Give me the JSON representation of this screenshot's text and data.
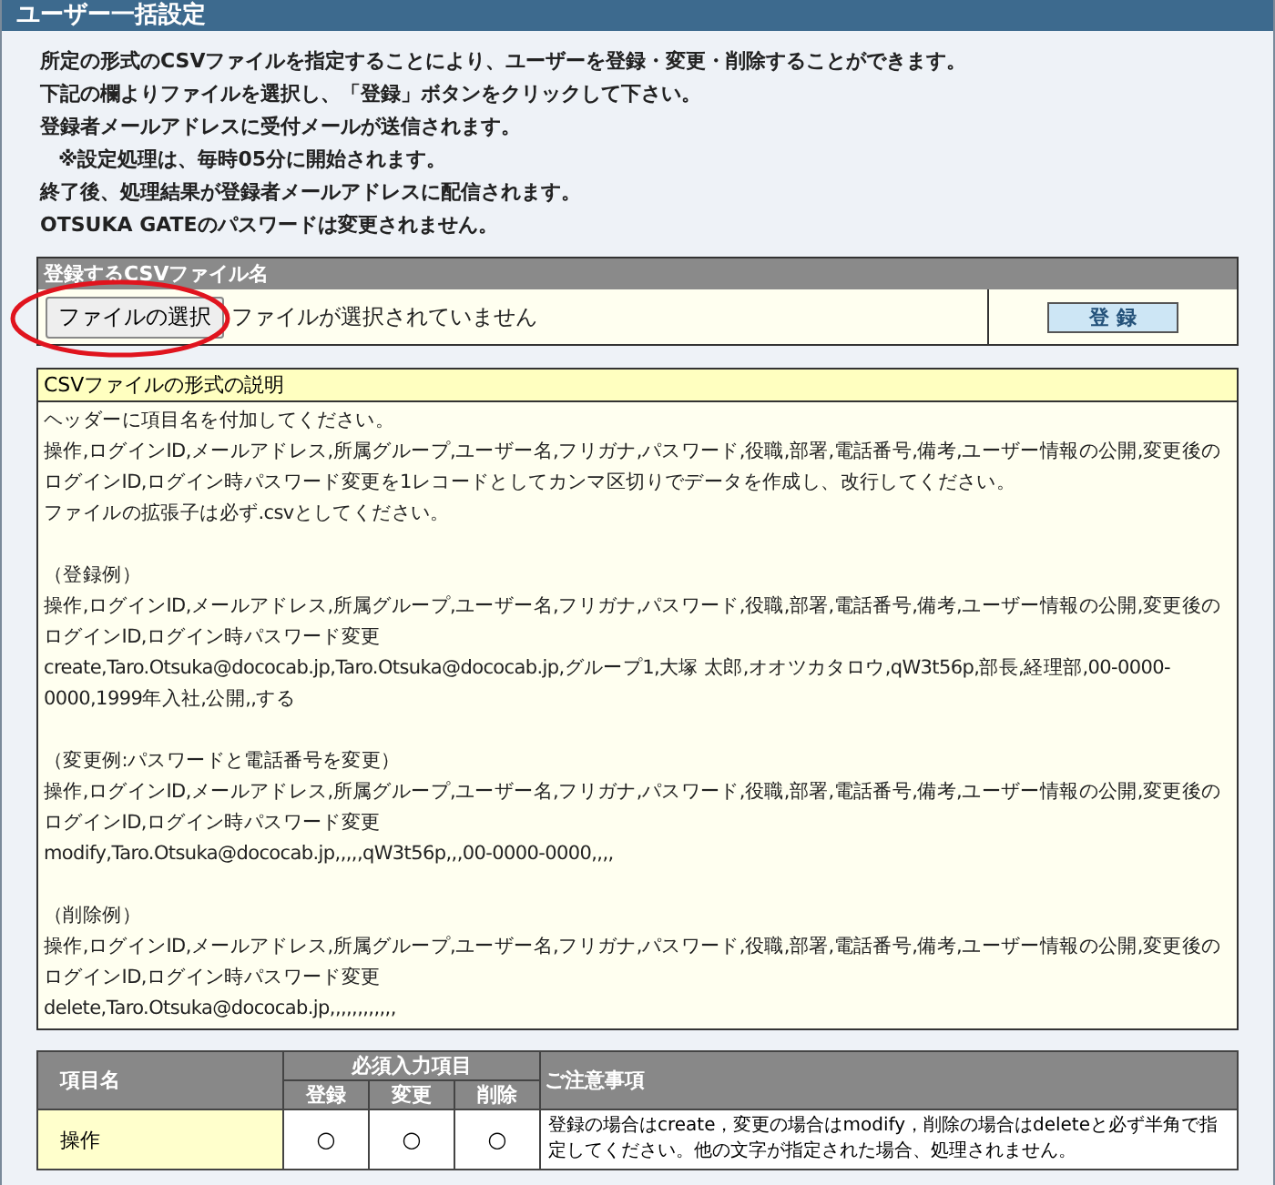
{
  "header": {
    "title": "ユーザー一括設定"
  },
  "intro": [
    {
      "kind": "plain",
      "text": "所定の形式のCSVファイルを指定することにより、ユーザーを登録・変更・削除することができます。"
    },
    {
      "kind": "plain",
      "text": "下記の欄よりファイルを選択し、「登録」ボタンをクリックして下さい。"
    },
    {
      "kind": "plain",
      "text": "登録者メールアドレスに受付メールが送信されます。"
    },
    {
      "kind": "note",
      "text": "※設定処理は、毎時05分に開始されます。"
    },
    {
      "kind": "plain",
      "text": "終了後、処理結果が登録者メールアドレスに配信されます。"
    },
    {
      "kind": "plain",
      "text": "OTSUKA GATEのパスワードは変更されません。"
    }
  ],
  "upload": {
    "label": "登録するCSVファイル名",
    "choose_button": "ファイルの選択",
    "file_status": "ファイルが選択されていません",
    "submit_button": "登 録"
  },
  "format_help": {
    "title": "CSVファイルの形式の説明",
    "sections": [
      {
        "lines": [
          "ヘッダーに項目名を付加してください。",
          "操作,ログインID,メールアドレス,所属グループ,ユーザー名,フリガナ,パスワード,役職,部署,電話番号,備考,ユーザー情報の公開,変更後のログインID,ログイン時パスワード変更を1レコードとしてカンマ区切りでデータを作成し、改行してください。",
          "ファイルの拡張子は必ず.csvとしてください。"
        ]
      },
      {
        "lines": [
          "（登録例）",
          "操作,ログインID,メールアドレス,所属グループ,ユーザー名,フリガナ,パスワード,役職,部署,電話番号,備考,ユーザー情報の公開,変更後のログインID,ログイン時パスワード変更",
          "create,Taro.Otsuka@dococab.jp,Taro.Otsuka@dococab.jp,グループ1,大塚 太郎,オオツカタロウ,qW3t56p,部長,経理部,00-0000-0000,1999年入社,公開,,する"
        ]
      },
      {
        "lines": [
          "（変更例:パスワードと電話番号を変更）",
          "操作,ログインID,メールアドレス,所属グループ,ユーザー名,フリガナ,パスワード,役職,部署,電話番号,備考,ユーザー情報の公開,変更後のログインID,ログイン時パスワード変更",
          "modify,Taro.Otsuka@dococab.jp,,,,,qW3t56p,,,00-0000-0000,,,,"
        ]
      },
      {
        "lines": [
          "（削除例）",
          "操作,ログインID,メールアドレス,所属グループ,ユーザー名,フリガナ,パスワード,役職,部署,電話番号,備考,ユーザー情報の公開,変更後のログインID,ログイン時パスワード変更",
          "delete,Taro.Otsuka@dococab.jp,,,,,,,,,,,,"
        ]
      }
    ]
  },
  "table": {
    "name_header": "項目名",
    "required_header": "必須入力項目",
    "required_columns": [
      "登録",
      "変更",
      "削除"
    ],
    "notes_header": "ご注意事項",
    "rows": [
      {
        "name": "操作",
        "required": [
          "○",
          "○",
          "○"
        ],
        "note": "登録の場合はcreate，変更の場合はmodify，削除の場合はdeleteと必ず半角で指定してください。他の文字が指定された場合、処理されません。"
      }
    ]
  }
}
